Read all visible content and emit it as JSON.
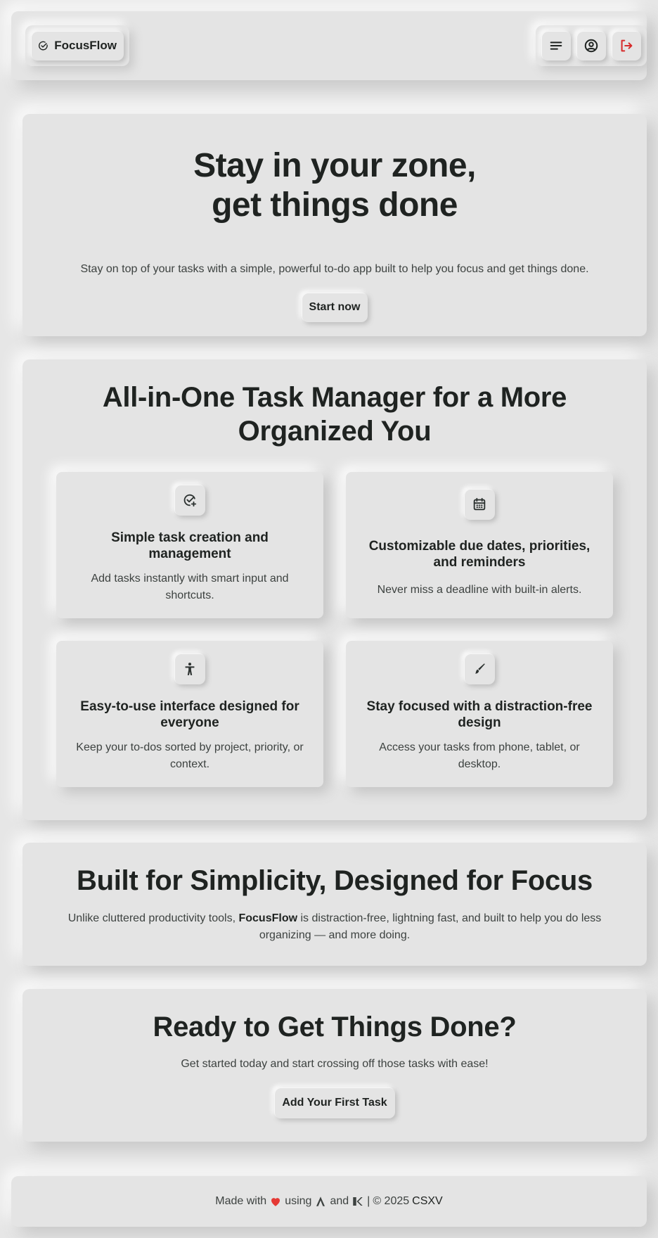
{
  "header": {
    "brand": "FocusFlow",
    "accent_logout": "#d62b2b"
  },
  "hero": {
    "title_line1": "Stay in your zone,",
    "title_line2": "get things done",
    "subtitle": "Stay on top of your tasks with a simple, powerful to-do app built to help you focus and get things done.",
    "cta": "Start now"
  },
  "features": {
    "title_line1": "All-in-One Task Manager for a More",
    "title_line2": "Organized You",
    "cards": [
      {
        "icon": "task-add-icon",
        "title": "Simple task creation and management",
        "text": "Add tasks instantly with smart input and shortcuts."
      },
      {
        "icon": "calendar-icon",
        "title": "Customizable due dates, priorities, and reminders",
        "text": "Never miss a deadline with built-in alerts."
      },
      {
        "icon": "accessibility-icon",
        "title": "Easy-to-use interface designed for everyone",
        "text": "Keep your to-dos sorted by project, priority, or context."
      },
      {
        "icon": "brush-icon",
        "title": "Stay focused with a distraction-free design",
        "text": "Access your tasks from phone, tablet, or desktop."
      }
    ]
  },
  "simplicity": {
    "title": "Built for Simplicity, Designed for Focus",
    "text_before": "Unlike cluttered productivity tools,",
    "text_brand": "FocusFlow",
    "text_after": "is distraction-free, lightning fast, and built to help you do less organizing — and more doing."
  },
  "ready": {
    "title": "Ready to Get Things Done?",
    "subtitle": "Get started today and start crossing off those tasks with ease!",
    "cta": "Add Your First Task"
  },
  "footer": {
    "made_with": "Made with",
    "using": "using",
    "and": "and",
    "separator": "|",
    "copyright": "© 2025",
    "author": "CSXV",
    "heart_color": "#e53935"
  }
}
